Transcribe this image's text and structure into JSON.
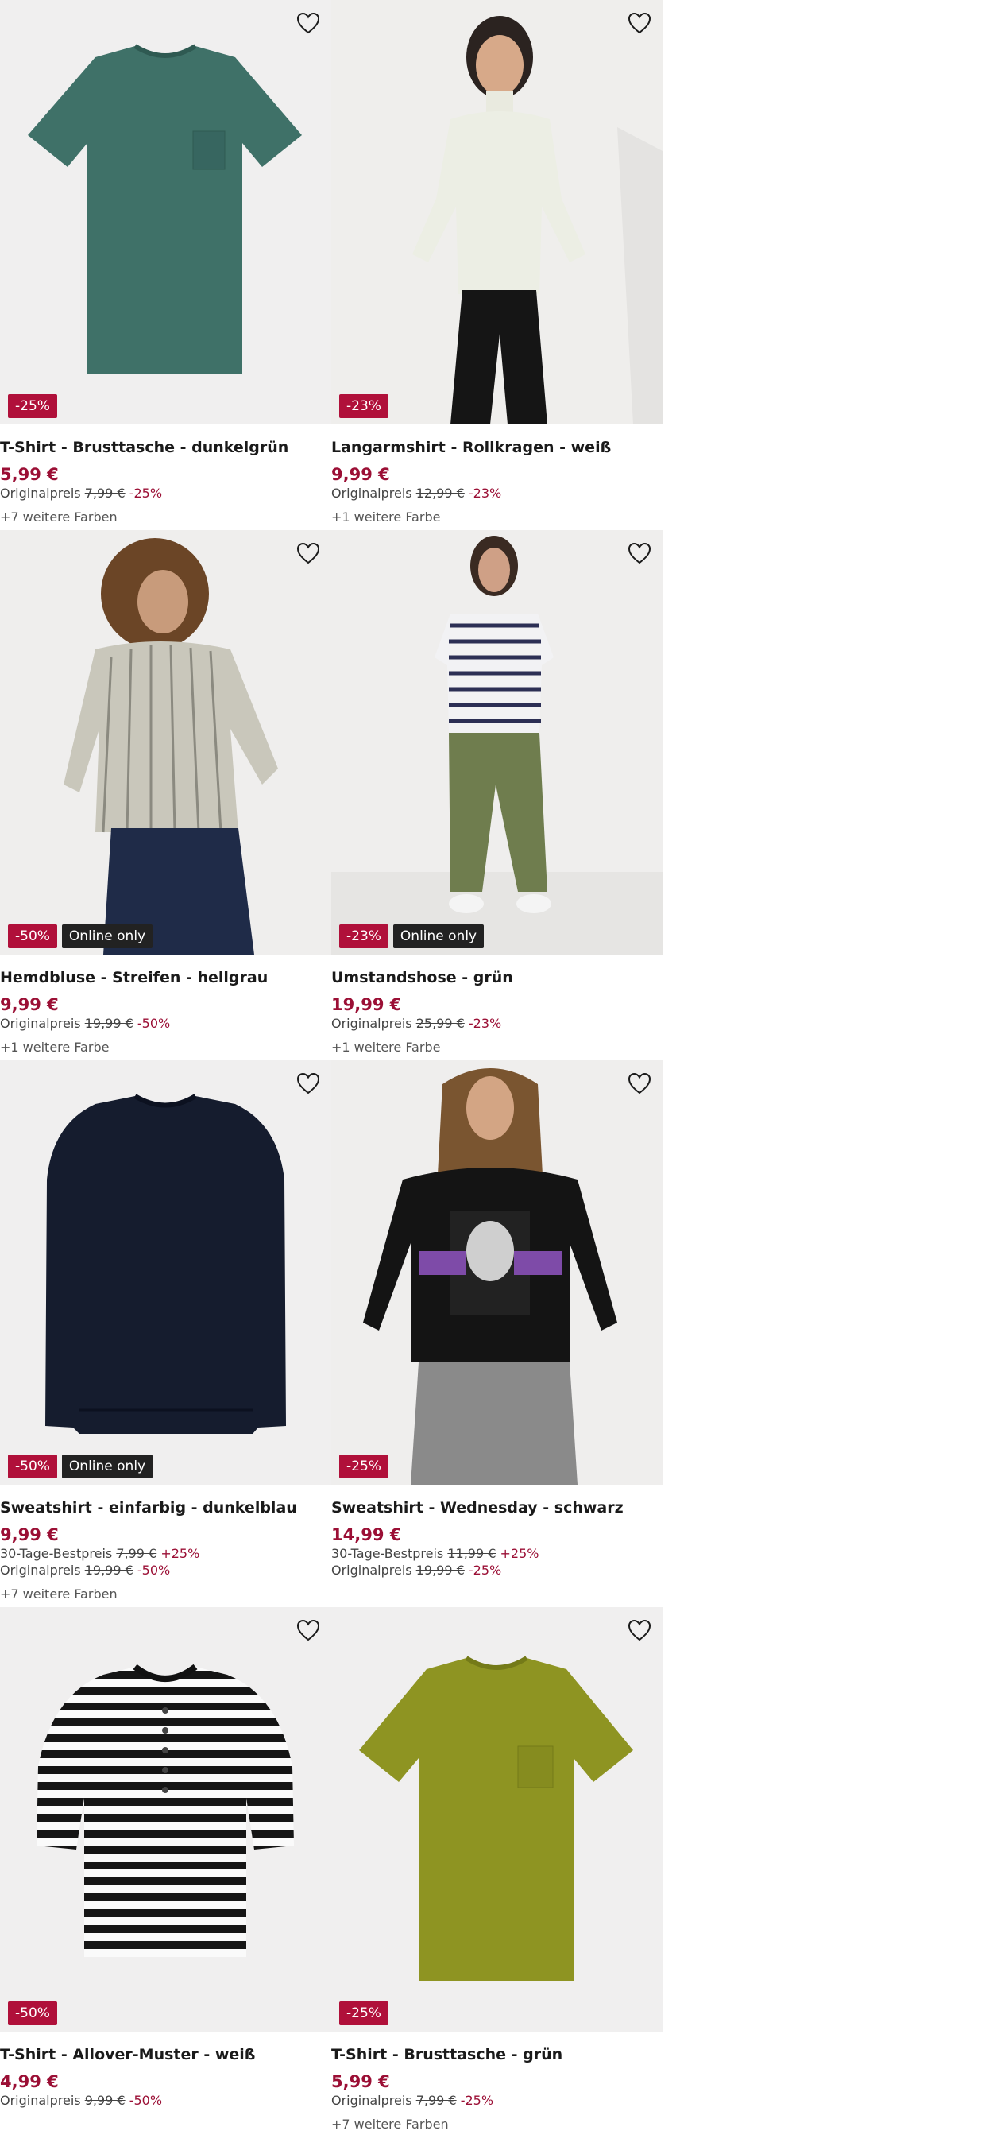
{
  "colors": {
    "discount_badge": "#b0103a",
    "online_badge": "#222222",
    "price": "#9b0f35",
    "image_bg": "#f0efef"
  },
  "products": [
    {
      "title": "T-Shirt - Brusttasche - dunkelgrün",
      "price": "5,99 €",
      "badges": [
        "-25%"
      ],
      "price_lines": [
        {
          "label": "Originalpreis",
          "old": "7,99 €",
          "pct": "-25%"
        }
      ],
      "colors_text": "+7 weitere Farben",
      "image": "tshirt-dark-green"
    },
    {
      "title": "Langarmshirt - Rollkragen - weiß",
      "price": "9,99 €",
      "badges": [
        "-23%"
      ],
      "price_lines": [
        {
          "label": "Originalpreis",
          "old": "12,99 €",
          "pct": "-23%"
        }
      ],
      "colors_text": "+1 weitere Farbe",
      "image": "model-white-turtleneck"
    },
    {
      "title": "Hemdbluse - Streifen - hellgrau",
      "price": "9,99 €",
      "badges": [
        "-50%",
        "Online only"
      ],
      "price_lines": [
        {
          "label": "Originalpreis",
          "old": "19,99 €",
          "pct": "-50%"
        }
      ],
      "colors_text": "+1 weitere Farbe",
      "image": "model-striped-blouse"
    },
    {
      "title": "Umstandshose - grün",
      "price": "19,99 €",
      "badges": [
        "-23%",
        "Online only"
      ],
      "price_lines": [
        {
          "label": "Originalpreis",
          "old": "25,99 €",
          "pct": "-23%"
        }
      ],
      "colors_text": "+1 weitere Farbe",
      "image": "model-green-maternity-pants"
    },
    {
      "title": "Sweatshirt - einfarbig - dunkelblau",
      "price": "9,99 €",
      "badges": [
        "-50%",
        "Online only"
      ],
      "price_lines": [
        {
          "label": "30-Tage-Bestpreis",
          "old": "7,99 €",
          "pct": "+25%"
        },
        {
          "label": "Originalpreis",
          "old": "19,99 €",
          "pct": "-50%"
        }
      ],
      "colors_text": "+7 weitere Farben",
      "image": "sweatshirt-navy"
    },
    {
      "title": "Sweatshirt - Wednesday - schwarz",
      "price": "14,99 €",
      "badges": [
        "-25%"
      ],
      "price_lines": [
        {
          "label": "30-Tage-Bestpreis",
          "old": "11,99 €",
          "pct": "+25%"
        },
        {
          "label": "Originalpreis",
          "old": "19,99 €",
          "pct": "-25%"
        }
      ],
      "colors_text": "",
      "image": "model-wednesday-sweatshirt"
    },
    {
      "title": "T-Shirt - Allover-Muster - weiß",
      "price": "4,99 €",
      "badges": [
        "-50%"
      ],
      "price_lines": [
        {
          "label": "Originalpreis",
          "old": "9,99 €",
          "pct": "-50%"
        }
      ],
      "colors_text": "",
      "image": "striped-henley-shirt"
    },
    {
      "title": "T-Shirt - Brusttasche - grün",
      "price": "5,99 €",
      "badges": [
        "-25%"
      ],
      "price_lines": [
        {
          "label": "Originalpreis",
          "old": "7,99 €",
          "pct": "-25%"
        }
      ],
      "colors_text": "+7 weitere Farben",
      "image": "tshirt-olive-green"
    }
  ]
}
